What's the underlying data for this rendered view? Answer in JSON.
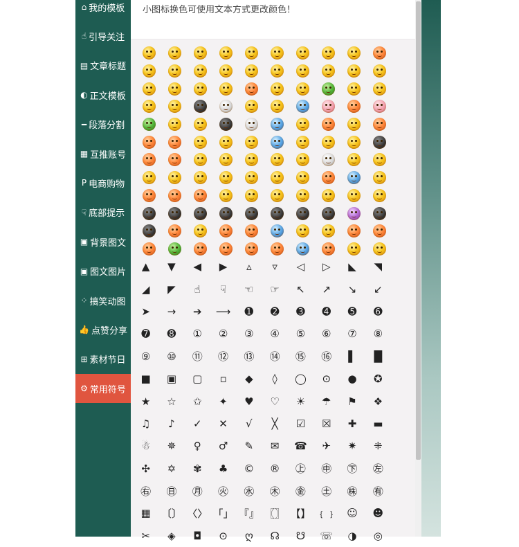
{
  "sidebar": {
    "items": [
      {
        "label": "我的模板",
        "icon": "home-icon",
        "glyph": "⌂",
        "active": false
      },
      {
        "label": "引导关注",
        "icon": "pointer-hand-icon",
        "glyph": "☝",
        "active": false
      },
      {
        "label": "文章标题",
        "icon": "document-icon",
        "glyph": "▤",
        "active": false
      },
      {
        "label": "正文模板",
        "icon": "contrast-icon",
        "glyph": "◐",
        "active": false
      },
      {
        "label": "段落分割",
        "icon": "minus-icon",
        "glyph": "━",
        "active": false
      },
      {
        "label": "互推账号",
        "icon": "qrcode-icon",
        "glyph": "▦",
        "active": false
      },
      {
        "label": "电商购物",
        "icon": "paypal-icon",
        "glyph": "P",
        "active": false
      },
      {
        "label": "底部提示",
        "icon": "hand-down-icon",
        "glyph": "☟",
        "active": false
      },
      {
        "label": "背景图文",
        "icon": "image-icon",
        "glyph": "▣",
        "active": false
      },
      {
        "label": "图文图片",
        "icon": "picture-icon",
        "glyph": "▣",
        "active": false
      },
      {
        "label": "搞笑动图",
        "icon": "spinner-icon",
        "glyph": "⁘",
        "active": false
      },
      {
        "label": "点赞分享",
        "icon": "thumbs-up-icon",
        "glyph": "👍",
        "active": false
      },
      {
        "label": "素材节日",
        "icon": "gift-icon",
        "glyph": "⊞",
        "active": false
      },
      {
        "label": "常用符号",
        "icon": "cogs-icon",
        "glyph": "⚙",
        "active": true
      }
    ]
  },
  "notice": {
    "text": "小图标换色可使用文本方式更改颜色！"
  },
  "emoji": {
    "rows": 12,
    "cols": 10,
    "palette": [
      "yellow",
      "yellow",
      "yellow",
      "yellow",
      "yellow",
      "yellow",
      "yellow",
      "yellow",
      "yellow",
      "red",
      "yellow",
      "yellow",
      "yellow",
      "yellow",
      "yellow",
      "yellow",
      "yellow",
      "yellow",
      "yellow",
      "yellow",
      "yellow",
      "yellow",
      "yellow",
      "yellow",
      "red",
      "yellow",
      "yellow",
      "green",
      "yellow",
      "yellow",
      "yellow",
      "yellow",
      "dark",
      "grey",
      "yellow",
      "yellow",
      "blue",
      "pink",
      "red",
      "pink",
      "green",
      "yellow",
      "yellow",
      "dark",
      "grey",
      "blue",
      "yellow",
      "red",
      "yellow",
      "red",
      "red",
      "red",
      "yellow",
      "yellow",
      "yellow",
      "blue",
      "yellow",
      "yellow",
      "yellow",
      "dark",
      "red",
      "red",
      "yellow",
      "yellow",
      "yellow",
      "yellow",
      "yellow",
      "grey",
      "yellow",
      "yellow",
      "yellow",
      "yellow",
      "yellow",
      "yellow",
      "yellow",
      "yellow",
      "yellow",
      "red",
      "blue",
      "yellow",
      "red",
      "red",
      "red",
      "yellow",
      "yellow",
      "yellow",
      "yellow",
      "yellow",
      "yellow",
      "yellow",
      "dark",
      "dark",
      "dark",
      "dark",
      "dark",
      "dark",
      "dark",
      "dark",
      "purple",
      "dark",
      "dark",
      "red",
      "yellow",
      "red",
      "red",
      "blue",
      "yellow",
      "yellow",
      "red",
      "red",
      "red",
      "green",
      "red",
      "red",
      "red",
      "red",
      "blue",
      "red",
      "yellow",
      "yellow"
    ]
  },
  "symbols": [
    "▲",
    "▼",
    "◀",
    "▶",
    "▵",
    "▿",
    "◁",
    "▷",
    "◣",
    "◥",
    "◢",
    "◤",
    "☝",
    "☟",
    "☜",
    "☞",
    "↖",
    "↗",
    "↘",
    "↙",
    "➤",
    "→",
    "➔",
    "⟶",
    "➊",
    "➋",
    "➌",
    "➍",
    "➎",
    "➏",
    "➐",
    "➑",
    "①",
    "②",
    "③",
    "④",
    "⑤",
    "⑥",
    "⑦",
    "⑧",
    "⑨",
    "⑩",
    "⑪",
    "⑫",
    "⑬",
    "⑭",
    "⑮",
    "⑯",
    "▌",
    "█",
    "■",
    "▣",
    "▢",
    "▫",
    "◆",
    "◊",
    "◯",
    "⊙",
    "●",
    "✪",
    "★",
    "☆",
    "✩",
    "✦",
    "♥",
    "♡",
    "☀",
    "☂",
    "⚑",
    "❖",
    "♫",
    "♪",
    "✓",
    "✕",
    "√",
    "╳",
    "☑",
    "☒",
    "✚",
    "▬",
    "☃",
    "✵",
    "♀",
    "♂",
    "✎",
    "✉",
    "☎",
    "✈",
    "✷",
    "⁜",
    "✣",
    "✡",
    "✾",
    "♣",
    "©",
    "®",
    "㊤",
    "㊥",
    "㊦",
    "㊧",
    "㊨",
    "㊐",
    "㊊",
    "㊋",
    "㊌",
    "㊍",
    "㊎",
    "㊏",
    "㊑",
    "㊒",
    "▦",
    "〔〕",
    "〈〉",
    "「」",
    "『』",
    "〖〗",
    "【】",
    "﹛﹜",
    "☺",
    "☻",
    "✂",
    "◈",
    "◘",
    "⊙",
    "ღ",
    "☊",
    "☋",
    "☏",
    "◑",
    "◎"
  ]
}
